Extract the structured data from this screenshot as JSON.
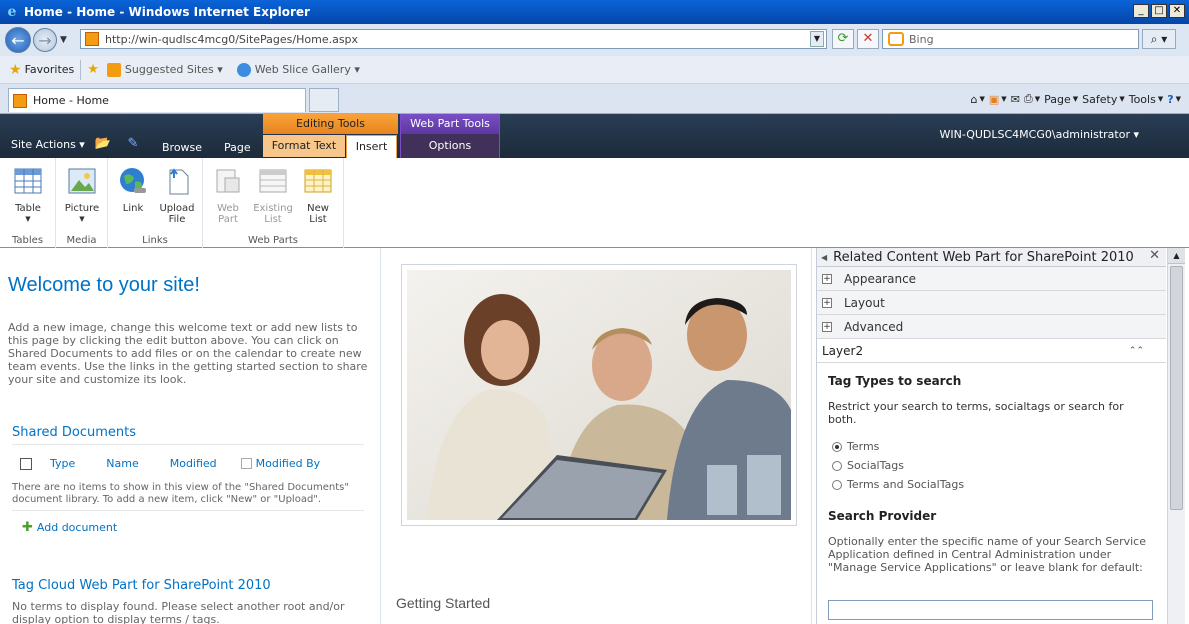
{
  "window": {
    "title": "Home - Home - Windows Internet Explorer",
    "minimize": "_",
    "maximize": "□",
    "close": "✕"
  },
  "address": {
    "url": "http://win-qudlsc4mcg0/SitePages/Home.aspx",
    "search_placeholder": "Bing"
  },
  "favorites": {
    "label": "Favorites",
    "items": [
      "Suggested Sites ▾",
      "Web Slice Gallery ▾"
    ]
  },
  "tabs": {
    "active": "Home - Home"
  },
  "commandbar": {
    "page": "Page",
    "safety": "Safety",
    "tools": "Tools"
  },
  "sharepoint": {
    "site_actions": "Site Actions ▾",
    "tabs": {
      "browse": "Browse",
      "page": "Page",
      "format_text": "Format Text",
      "insert": "Insert",
      "options": "Options"
    },
    "context": {
      "editing_tools": "Editing Tools",
      "web_part_tools": "Web Part Tools"
    },
    "user": "WIN-QUDLSC4MCG0\\administrator ▾"
  },
  "ribbon": {
    "groups": {
      "tables": "Tables",
      "media": "Media",
      "links": "Links",
      "web_parts": "Web Parts"
    },
    "buttons": {
      "table": "Table",
      "picture": "Picture",
      "link": "Link",
      "upload_file_1": "Upload",
      "upload_file_2": "File",
      "web_part_1": "Web",
      "web_part_2": "Part",
      "existing_list_1": "Existing",
      "existing_list_2": "List",
      "new_list_1": "New",
      "new_list_2": "List"
    }
  },
  "main": {
    "welcome_title": "Welcome to your site!",
    "welcome_text": "Add a new image, change this welcome text or add new lists to this page by clicking the edit button above. You can click on Shared Documents to add files or on the calendar to create new team events. Use the links in the getting started section to share your site and customize its look.",
    "shared_docs": {
      "title": "Shared Documents",
      "columns": [
        "Type",
        "Name",
        "Modified",
        "Modified By"
      ],
      "empty": "There are no items to show in this view of the \"Shared Documents\" document library. To add a new item, click \"New\" or \"Upload\".",
      "add": "Add document"
    },
    "tag_cloud": {
      "title": "Tag Cloud Web Part for SharePoint 2010",
      "text": "No terms to display found. Please select another root and/or display option to display terms / tags."
    },
    "getting_started": "Getting Started"
  },
  "toolpane": {
    "title": "Related Content Web Part for SharePoint 2010",
    "sections": [
      "Appearance",
      "Layout",
      "Advanced"
    ],
    "layer": "Layer2",
    "tag_types_heading": "Tag Types to search",
    "tag_types_desc": "Restrict your search to terms, socialtags or search for both.",
    "options": [
      "Terms",
      "SocialTags",
      "Terms and SocialTags"
    ],
    "selected_option": "Terms",
    "provider_heading": "Search Provider",
    "provider_desc": "Optionally enter the specific name of your Search Service Application defined in Central Administration under \"Manage Service Applications\" or leave blank for default:",
    "provider_value": ""
  },
  "colors": {
    "ribbon_dark": "#1d2b3b",
    "editing_tools": "#e8841f",
    "web_part_tools": "#5c38a0",
    "link_blue": "#0072c6"
  }
}
